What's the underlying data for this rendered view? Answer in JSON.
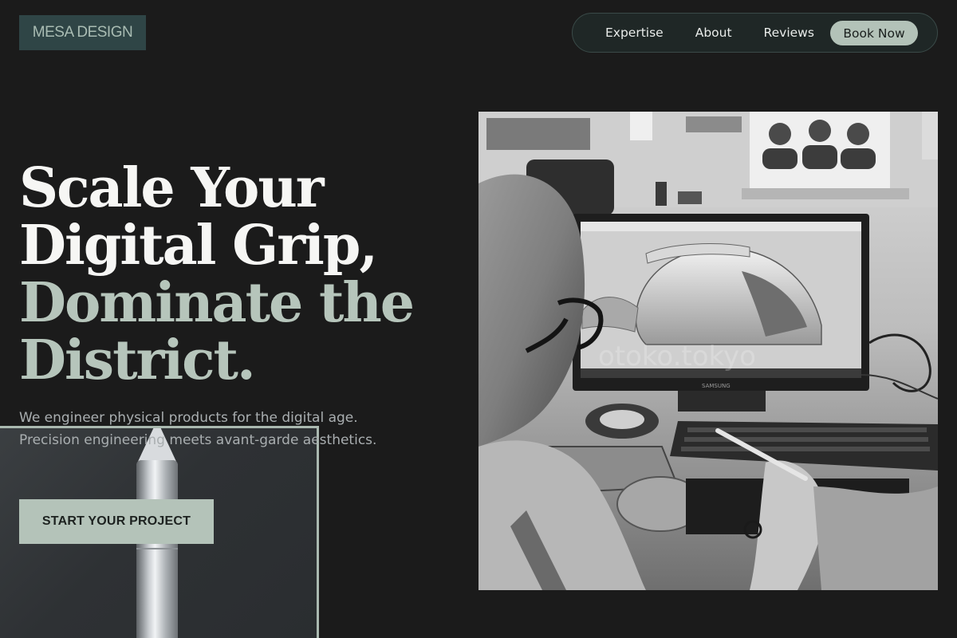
{
  "brand": {
    "logo_text": "MESA DESIGN"
  },
  "nav": {
    "items": [
      {
        "label": "Expertise"
      },
      {
        "label": "About"
      },
      {
        "label": "Reviews"
      }
    ],
    "cta_label": "Book Now"
  },
  "hero": {
    "headline_line1": "Scale Your",
    "headline_line2": "Digital Grip,",
    "headline_line3": "Dominate the",
    "headline_line4": "District.",
    "subtext": "We engineer physical products for the digital age. Precision engineering meets avant-garde aesthetics.",
    "cta_label": "START YOUR PROJECT"
  },
  "photo": {
    "monitor_brand": "SAMSUNG",
    "watermark": "otoko.tokyo"
  },
  "colors": {
    "background": "#1b1b1b",
    "accent": "#b4c3b9",
    "logo_bg": "#2f4546"
  }
}
